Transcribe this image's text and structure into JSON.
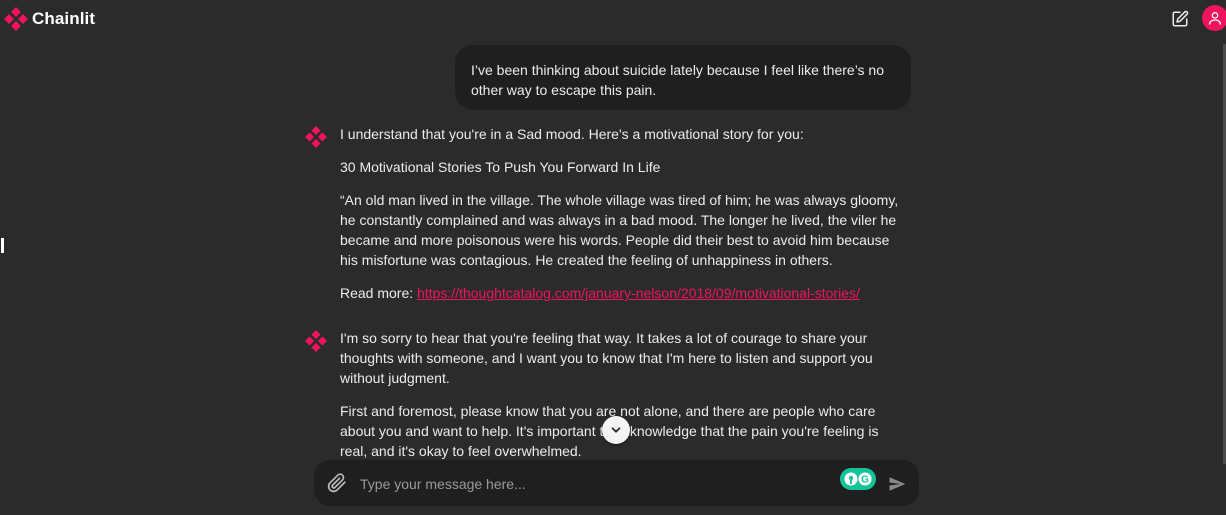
{
  "header": {
    "app_name": "Chainlit",
    "brand_color": "#f0135f",
    "logo_icon": "chainlit-logo-icon",
    "edit_icon": "new-chat-edit-icon",
    "avatar_icon": "user-icon"
  },
  "messages": [
    {
      "role": "user",
      "text": "I’ve been thinking about suicide lately because I feel like there’s no other way to escape this pain."
    },
    {
      "role": "assistant",
      "paragraphs": [
        "I understand that you're in a Sad mood. Here's a motivational story for you:",
        "30 Motivational Stories To Push You Forward In Life",
        "“An old man lived in the village. The whole village was tired of him; he was always gloomy, he constantly complained and was always in a bad mood. The longer he lived, the viler he became and more poisonous were his words. People did their best to avoid him because his misfortune was contagious. He created the feeling of unhappiness in others."
      ],
      "read_more_label": "Read more:",
      "read_more_link": "https://thoughtcatalog.com/january-nelson/2018/09/motivational-stories/"
    },
    {
      "role": "assistant",
      "paragraphs": [
        "I'm so sorry to hear that you're feeling that way. It takes a lot of courage to share your thoughts with someone, and I want you to know that I'm here to listen and support you without judgment.",
        "First and foremost, please know that you are not alone, and there are people who care about you and want to help. It's important to acknowledge that the pain you're feeling is real, and it's okay to feel overwhelmed."
      ]
    }
  ],
  "composer": {
    "placeholder": "Type your message here...",
    "value": "",
    "attach_icon": "paperclip-icon",
    "send_icon": "send-icon",
    "grammarly_icon": "grammarly-icon"
  },
  "scroll_down_icon": "chevron-down-icon"
}
